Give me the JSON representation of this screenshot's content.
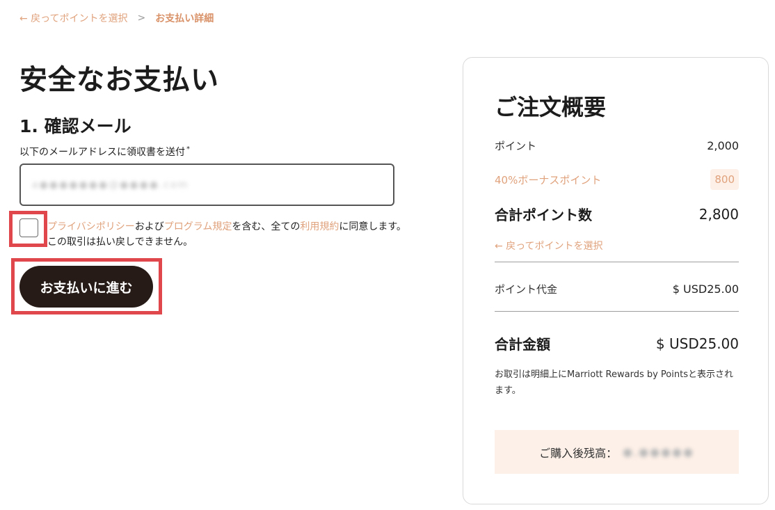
{
  "breadcrumb": {
    "back_label": "← 戻ってポイントを選択",
    "separator": ">",
    "current": "お支払い詳細"
  },
  "page_title": "安全なお支払い",
  "section_title": "1. 確認メール",
  "email": {
    "label": "以下のメールアドレスに領収書を送付",
    "required_mark": "*",
    "value_blurred": "a●●●●●●●@●●●●.com"
  },
  "consent": {
    "link_privacy": "プライバシポリシー",
    "text_and": "および",
    "link_program": "プログラム規定",
    "text_include": "を含む、全ての",
    "link_terms": "利用規約",
    "text_rest": "に同意します。この取引は払い戻しできません。"
  },
  "pay_button_label": "お支払いに進む",
  "summary": {
    "title": "ご注文概要",
    "points_label": "ポイント",
    "points_value": "2,000",
    "bonus_label": "40%ボーナスポイント",
    "bonus_value": "800",
    "total_points_label": "合計ポイント数",
    "total_points_value": "2,800",
    "back_link": "← 戻ってポイントを選択",
    "price_label": "ポイント代金",
    "price_value": "$ USD25.00",
    "grand_label": "合計金額",
    "grand_value": "$ USD25.00",
    "note": "お取引は明細上にMarriott Rewards by Pointsと表示されます。",
    "balance_label": "ご購入後残高：",
    "balance_value_blurred": "●,●●●●●"
  },
  "colors": {
    "accent": "#e0a27c",
    "highlight": "#e0474c",
    "button_bg": "#261b16",
    "bonus_bg": "#fdf0e8"
  }
}
